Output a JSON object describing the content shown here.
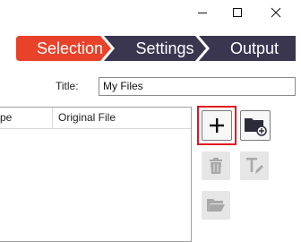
{
  "window": {
    "controls": {
      "minimize_icon": "minimize-icon",
      "maximize_icon": "maximize-icon",
      "close_icon": "close-icon"
    }
  },
  "wizard": {
    "steps": [
      {
        "label": "Selection",
        "active": true
      },
      {
        "label": "Settings",
        "active": false
      },
      {
        "label": "Output",
        "active": false
      }
    ],
    "active_color": "#e8422a",
    "inactive_color": "#3a3650"
  },
  "title_field": {
    "label": "Title:",
    "value": "My Files"
  },
  "file_table": {
    "columns": [
      "pe",
      "Original File"
    ],
    "rows": []
  },
  "toolbar": {
    "add_file_icon": "plus-icon",
    "add_folder_icon": "add-folder-icon",
    "remove_icon": "trash-icon",
    "rename_icon": "rename-icon",
    "open_folder_icon": "folder-icon",
    "highlight_color": "#e0141e"
  }
}
